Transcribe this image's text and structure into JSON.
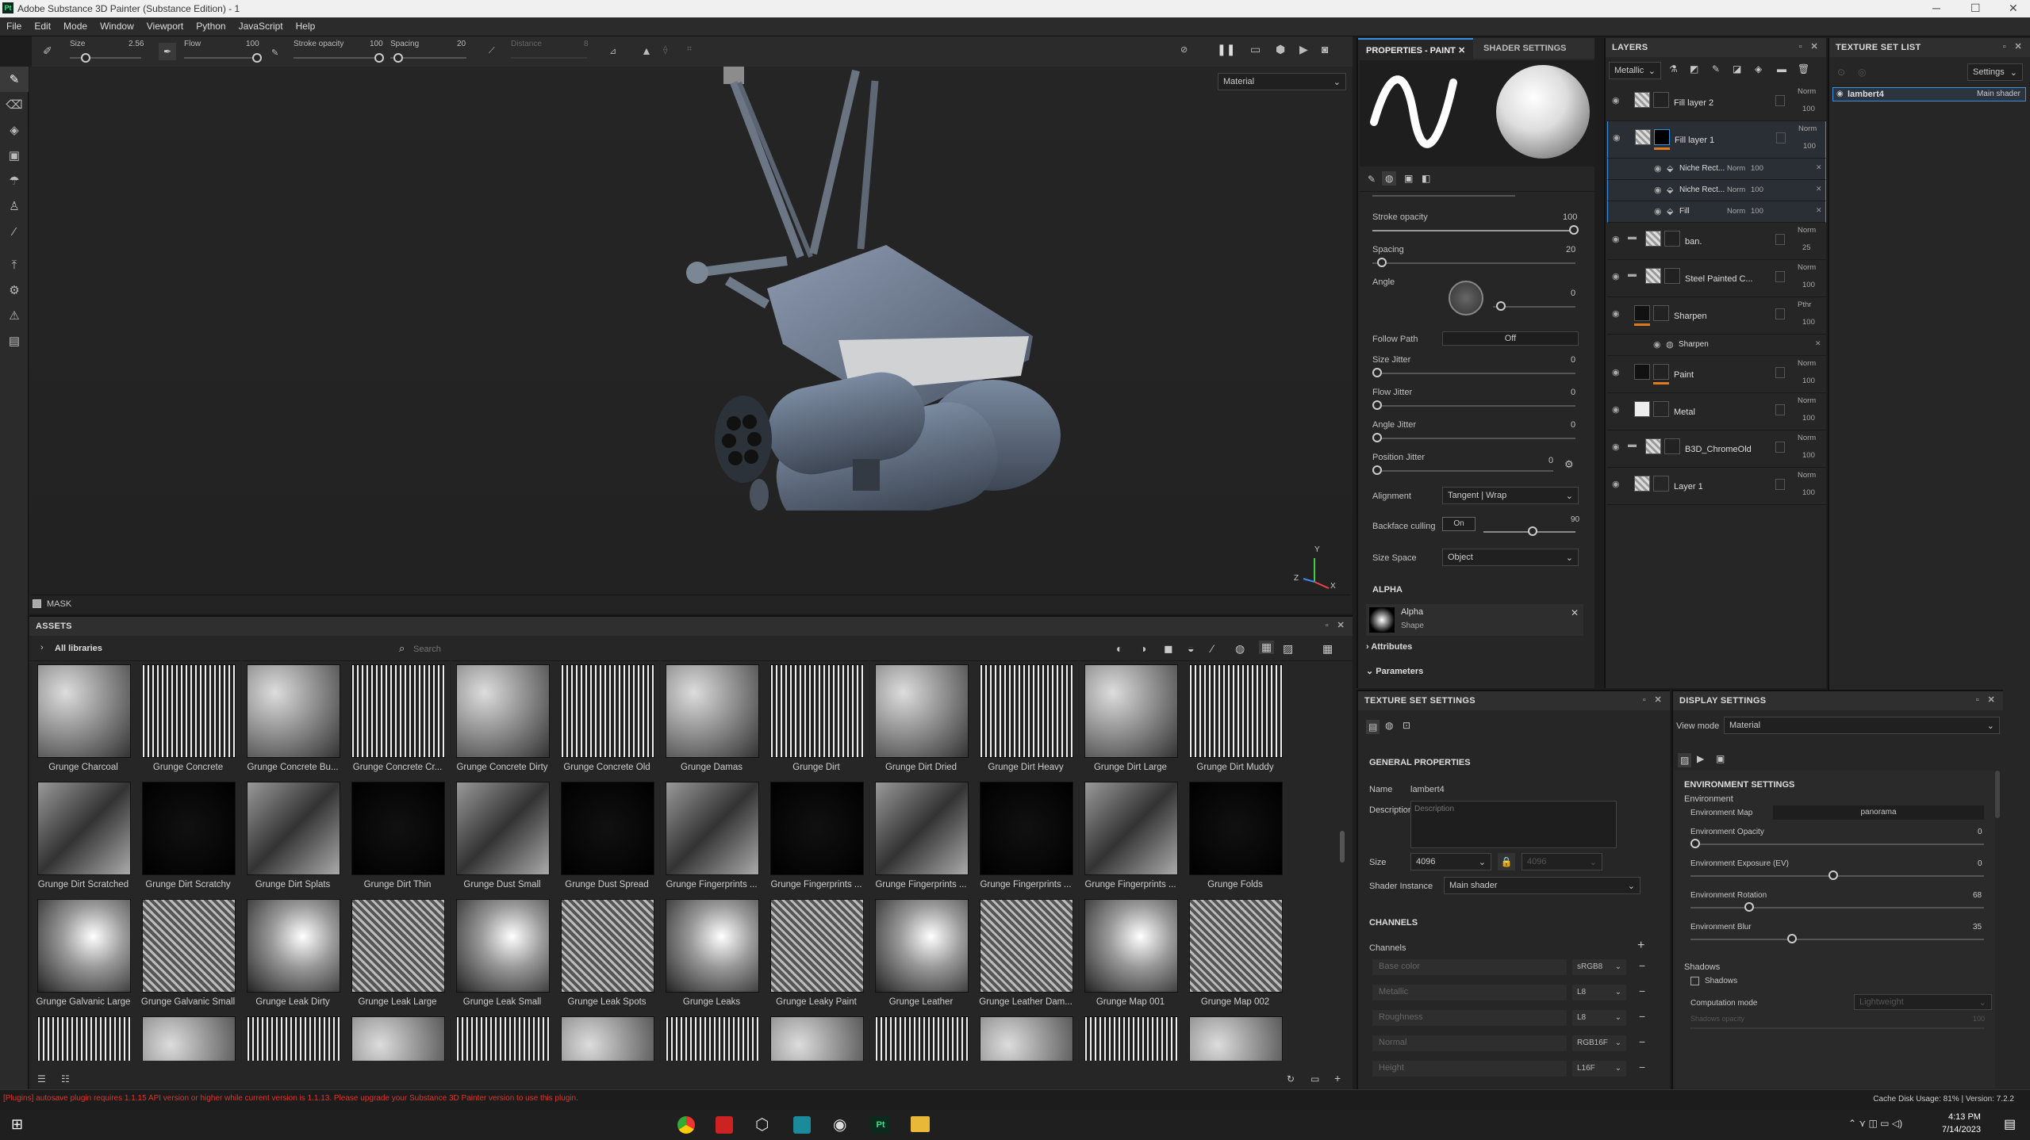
{
  "window": {
    "title": "Adobe Substance 3D Painter (Substance Edition) - 1",
    "app_icon": "Pt"
  },
  "menu": [
    "File",
    "Edit",
    "Mode",
    "Window",
    "Viewport",
    "Python",
    "JavaScript",
    "Help"
  ],
  "toolbar": {
    "size_label": "Size",
    "size_value": "2.56",
    "flow_label": "Flow",
    "flow_value": "100",
    "stroke_opacity_label": "Stroke opacity",
    "stroke_opacity_value": "100",
    "spacing_label": "Spacing",
    "spacing_value": "20",
    "distance_label": "Distance",
    "distance_value": "8"
  },
  "viewport": {
    "mode": "Material",
    "mask_label": "MASK",
    "axis": {
      "x": "X",
      "y": "Y",
      "z": "Z"
    }
  },
  "assets": {
    "title": "ASSETS",
    "library": "All libraries",
    "search_placeholder": "Search",
    "rows": [
      [
        "Grunge Charcoal",
        "Grunge Concrete",
        "Grunge Concrete Bu...",
        "Grunge Concrete Cr...",
        "Grunge Concrete Dirty",
        "Grunge Concrete Old",
        "Grunge Damas",
        "Grunge Dirt",
        "Grunge Dirt Dried",
        "Grunge Dirt Heavy",
        "Grunge Dirt Large",
        "Grunge Dirt Muddy"
      ],
      [
        "Grunge Dirt Scratched",
        "Grunge Dirt Scratchy",
        "Grunge Dirt Splats",
        "Grunge Dirt Thin",
        "Grunge Dust Small",
        "Grunge Dust Spread",
        "Grunge Fingerprints ...",
        "Grunge Fingerprints ...",
        "Grunge Fingerprints ...",
        "Grunge Fingerprints ...",
        "Grunge Fingerprints ...",
        "Grunge Folds"
      ],
      [
        "Grunge Galvanic Large",
        "Grunge Galvanic Small",
        "Grunge Leak Dirty",
        "Grunge Leak Large",
        "Grunge Leak Small",
        "Grunge Leak Spots",
        "Grunge Leaks",
        "Grunge Leaky Paint",
        "Grunge Leather",
        "Grunge Leather Dam...",
        "Grunge Map 001",
        "Grunge Map 002"
      ],
      [
        "",
        "",
        "",
        "",
        "",
        "",
        "",
        "",
        "",
        "",
        "",
        ""
      ]
    ]
  },
  "properties": {
    "tab_paint": "PROPERTIES - PAINT",
    "tab_shader": "SHADER SETTINGS",
    "stroke_opacity": {
      "label": "Stroke opacity",
      "value": "100"
    },
    "spacing": {
      "label": "Spacing",
      "value": "20"
    },
    "angle": {
      "label": "Angle",
      "value": "0"
    },
    "follow_path": {
      "label": "Follow Path",
      "value": "Off"
    },
    "size_jitter": {
      "label": "Size Jitter",
      "value": "0"
    },
    "flow_jitter": {
      "label": "Flow Jitter",
      "value": "0"
    },
    "angle_jitter": {
      "label": "Angle Jitter",
      "value": "0"
    },
    "position_jitter": {
      "label": "Position Jitter",
      "value": "0"
    },
    "alignment": {
      "label": "Alignment",
      "value": "Tangent | Wrap"
    },
    "backface": {
      "label": "Backface culling",
      "toggle": "On",
      "value": "90"
    },
    "size_space": {
      "label": "Size Space",
      "value": "Object"
    },
    "alpha_section": "ALPHA",
    "alpha_name": "Alpha",
    "alpha_sub": "Shape",
    "attributes": "Attributes",
    "parameters": "Parameters"
  },
  "layers": {
    "title": "LAYERS",
    "channel": "Metallic",
    "items": [
      {
        "name": "Fill layer 2",
        "blend": "Norm",
        "opacity": "100",
        "kind": "fill"
      },
      {
        "name": "Fill layer 1",
        "blend": "Norm",
        "opacity": "100",
        "kind": "fill-selected"
      },
      {
        "name": "Niche Rect...",
        "blend": "Norm",
        "opacity": "100",
        "kind": "sub"
      },
      {
        "name": "Niche Rect...",
        "blend": "Norm",
        "opacity": "100",
        "kind": "sub"
      },
      {
        "name": "Fill",
        "blend": "Norm",
        "opacity": "100",
        "kind": "sub"
      },
      {
        "name": "ban.",
        "blend": "Norm",
        "opacity": "25",
        "kind": "folder"
      },
      {
        "name": "Steel Painted C...",
        "blend": "Norm",
        "opacity": "100",
        "kind": "folder"
      },
      {
        "name": "Sharpen",
        "blend": "Pthr",
        "opacity": "100",
        "kind": "filter"
      },
      {
        "name": "Sharpen",
        "blend": "",
        "opacity": "",
        "kind": "sub2"
      },
      {
        "name": "Paint",
        "blend": "Norm",
        "opacity": "100",
        "kind": "paint"
      },
      {
        "name": "Metal",
        "blend": "Norm",
        "opacity": "100",
        "kind": "white"
      },
      {
        "name": "B3D_ChromeOld",
        "blend": "Norm",
        "opacity": "100",
        "kind": "folder"
      },
      {
        "name": "Layer 1",
        "blend": "Norm",
        "opacity": "100",
        "kind": "layer"
      }
    ]
  },
  "texture_set_list": {
    "title": "TEXTURE SET LIST",
    "settings": "Settings",
    "item": "lambert4",
    "shader": "Main shader"
  },
  "texture_set_settings": {
    "title": "TEXTURE SET SETTINGS",
    "general": "GENERAL PROPERTIES",
    "name_label": "Name",
    "name_value": "lambert4",
    "desc_label": "Description",
    "desc_placeholder": "Description",
    "size_label": "Size",
    "size_value": "4096",
    "size_value2": "4096",
    "shader_label": "Shader Instance",
    "shader_value": "Main shader",
    "channels_title": "CHANNELS",
    "channels_label": "Channels",
    "channels": [
      {
        "name": "Base color",
        "format": "sRGB8"
      },
      {
        "name": "Metallic",
        "format": "L8"
      },
      {
        "name": "Roughness",
        "format": "L8"
      },
      {
        "name": "Normal",
        "format": "RGB16F"
      },
      {
        "name": "Height",
        "format": "L16F"
      }
    ]
  },
  "display_settings": {
    "title": "DISPLAY SETTINGS",
    "view_mode_label": "View mode",
    "view_mode": "Material",
    "env_title": "ENVIRONMENT SETTINGS",
    "env": "Environment",
    "env_map_label": "Environment Map",
    "env_map": "panorama",
    "opacity_label": "Environment Opacity",
    "opacity": "0",
    "exposure_label": "Environment Exposure (EV)",
    "exposure": "0",
    "rotation_label": "Environment Rotation",
    "rotation": "68",
    "blur_label": "Environment Blur",
    "blur": "35",
    "shadows_title": "Shadows",
    "shadows_cb": "Shadows",
    "comp_label": "Computation mode",
    "comp": "Lightweight",
    "shadows_opacity": "Shadows opacity",
    "shadows_opacity_value": "100"
  },
  "status": {
    "message": "[Plugins] autosave plugin requires 1.1.15 API version or higher while current version is 1.1.13. Please upgrade your Substance 3D Painter version to use this plugin.",
    "cache": "Cache Disk Usage:  81% | Version: 7.2.2"
  },
  "taskbar": {
    "time": "4:13 PM",
    "date": "7/14/2023",
    "pinned": [
      "chrome",
      "app-red",
      "unity",
      "app-blue",
      "app-gray",
      "substance",
      "explorer"
    ]
  }
}
